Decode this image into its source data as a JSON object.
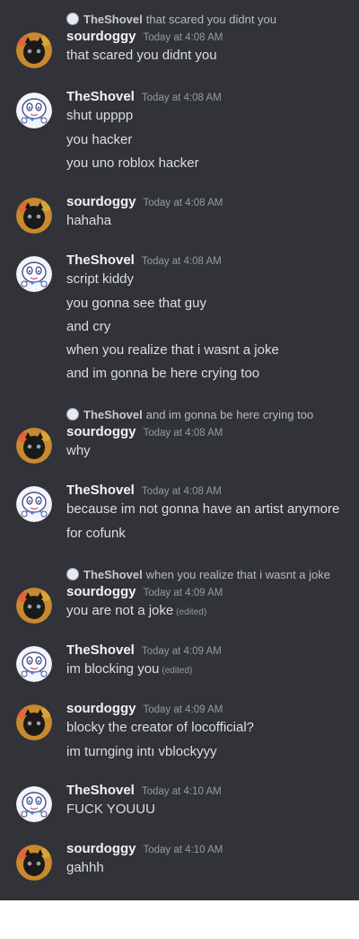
{
  "messages": [
    {
      "reply": {
        "author": "TheShovel",
        "text": "that scared you didnt you"
      },
      "author": "sourdoggy",
      "avatar": "black-cat-avatar",
      "timestamp": "Today at 4:08 AM",
      "lines": [
        {
          "text": "that scared you didnt you"
        }
      ]
    },
    {
      "author": "TheShovel",
      "avatar": "white-cartoon-avatar",
      "timestamp": "Today at 4:08 AM",
      "lines": [
        {
          "text": "shut upppp"
        },
        {
          "text": "you hacker"
        },
        {
          "text": "you uno roblox hacker"
        }
      ]
    },
    {
      "author": "sourdoggy",
      "avatar": "black-cat-avatar",
      "timestamp": "Today at 4:08 AM",
      "lines": [
        {
          "text": "hahaha"
        }
      ]
    },
    {
      "author": "TheShovel",
      "avatar": "white-cartoon-avatar",
      "timestamp": "Today at 4:08 AM",
      "lines": [
        {
          "text": "script kiddy"
        },
        {
          "text": "you gonna see that guy"
        },
        {
          "text": "and cry"
        },
        {
          "text": "when you realize that i wasnt a joke"
        },
        {
          "text": "and im gonna be here crying too"
        }
      ]
    },
    {
      "reply": {
        "author": "TheShovel",
        "text": "and im gonna be here crying too"
      },
      "author": "sourdoggy",
      "avatar": "black-cat-avatar",
      "timestamp": "Today at 4:08 AM",
      "lines": [
        {
          "text": "why"
        }
      ]
    },
    {
      "author": "TheShovel",
      "avatar": "white-cartoon-avatar",
      "timestamp": "Today at 4:08 AM",
      "lines": [
        {
          "text": "because im not gonna have an artist anymore"
        },
        {
          "text": "for cofunk"
        }
      ]
    },
    {
      "reply": {
        "author": "TheShovel",
        "text": "when you realize that i wasnt a joke"
      },
      "author": "sourdoggy",
      "avatar": "black-cat-avatar",
      "timestamp": "Today at 4:09 AM",
      "lines": [
        {
          "text": "you are not a joke",
          "edited": "(edited)"
        }
      ]
    },
    {
      "author": "TheShovel",
      "avatar": "white-cartoon-avatar",
      "timestamp": "Today at 4:09 AM",
      "lines": [
        {
          "text": "im blocking you",
          "edited": "(edited)"
        }
      ]
    },
    {
      "author": "sourdoggy",
      "avatar": "black-cat-avatar",
      "timestamp": "Today at 4:09 AM",
      "lines": [
        {
          "text": "blocky the creator of locofficial?"
        },
        {
          "text": "im turnging intı vblockyyy"
        }
      ]
    },
    {
      "author": "TheShovel",
      "avatar": "white-cartoon-avatar",
      "timestamp": "Today at 4:10 AM",
      "lines": [
        {
          "text": "FUCK YOUUU"
        }
      ]
    },
    {
      "author": "sourdoggy",
      "avatar": "black-cat-avatar",
      "timestamp": "Today at 4:10 AM",
      "lines": [
        {
          "text": "gahhh"
        }
      ]
    }
  ],
  "colors": {
    "background": "#313338",
    "author": "#f2f3f5",
    "message_text": "#dbdee1",
    "timestamp": "#949ba4"
  }
}
